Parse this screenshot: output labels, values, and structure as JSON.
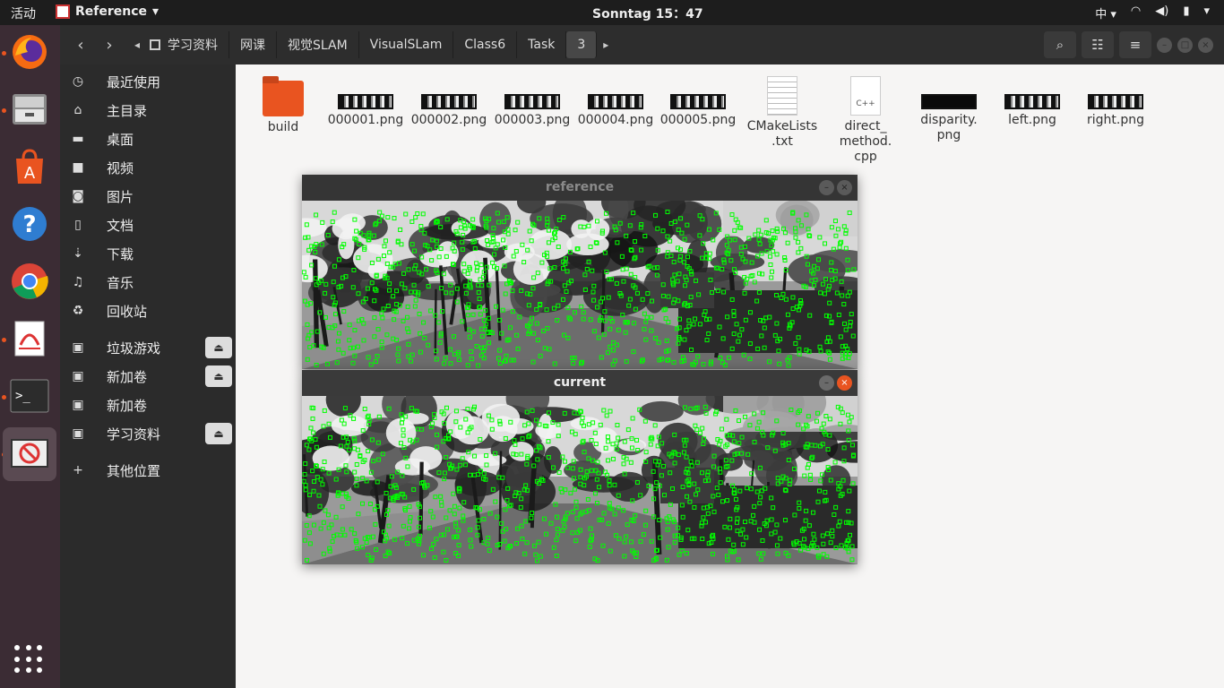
{
  "topbar": {
    "activities": "活动",
    "app_name": "Reference",
    "clock": "Sonntag 15：47",
    "input_method": "中"
  },
  "dock": {
    "items": [
      "firefox-icon",
      "files-icon",
      "software-center-icon",
      "help-icon",
      "chrome-icon",
      "document-viewer-icon",
      "terminal-icon",
      "opencv-window-icon"
    ],
    "show_apps": "show-applications-icon"
  },
  "headerbar": {
    "crumbs": [
      "学习资料",
      "网课",
      "视觉SLAM",
      "VisualSLam",
      "Class6",
      "Task",
      "3"
    ]
  },
  "sidebar": {
    "places": [
      {
        "icon": "recent-icon",
        "glyph": "◷",
        "label": "最近使用"
      },
      {
        "icon": "home-icon",
        "glyph": "⌂",
        "label": "主目录"
      },
      {
        "icon": "desktop-icon",
        "glyph": "▬",
        "label": "桌面"
      },
      {
        "icon": "video-icon",
        "glyph": "■",
        "label": "视频"
      },
      {
        "icon": "pictures-icon",
        "glyph": "◙",
        "label": "图片"
      },
      {
        "icon": "documents-icon",
        "glyph": "▯",
        "label": "文档"
      },
      {
        "icon": "downloads-icon",
        "glyph": "⇣",
        "label": "下载"
      },
      {
        "icon": "music-icon",
        "glyph": "♫",
        "label": "音乐"
      },
      {
        "icon": "trash-icon",
        "glyph": "♻",
        "label": "回收站"
      }
    ],
    "devices": [
      {
        "label": "垃圾游戏",
        "eject": true
      },
      {
        "label": "新加卷",
        "eject": true
      },
      {
        "label": "新加卷",
        "eject": false
      },
      {
        "label": "学习资料",
        "eject": true
      }
    ],
    "other": "其他位置"
  },
  "files": [
    {
      "name": "build",
      "kind": "folder"
    },
    {
      "name": "000001.png",
      "kind": "image"
    },
    {
      "name": "000002.png",
      "kind": "image"
    },
    {
      "name": "000003.png",
      "kind": "image"
    },
    {
      "name": "000004.png",
      "kind": "image"
    },
    {
      "name": "000005.png",
      "kind": "image"
    },
    {
      "name": "CMakeLists\n.txt",
      "kind": "text"
    },
    {
      "name": "direct_\nmethod.\ncpp",
      "kind": "cpp"
    },
    {
      "name": "disparity.\npng",
      "kind": "dark"
    },
    {
      "name": "left.png",
      "kind": "image"
    },
    {
      "name": "right.png",
      "kind": "image"
    }
  ],
  "windows": {
    "reference": {
      "title": "reference"
    },
    "current": {
      "title": "current"
    }
  },
  "colors": {
    "accent": "#e95420",
    "feature_points": "#00ff00"
  }
}
